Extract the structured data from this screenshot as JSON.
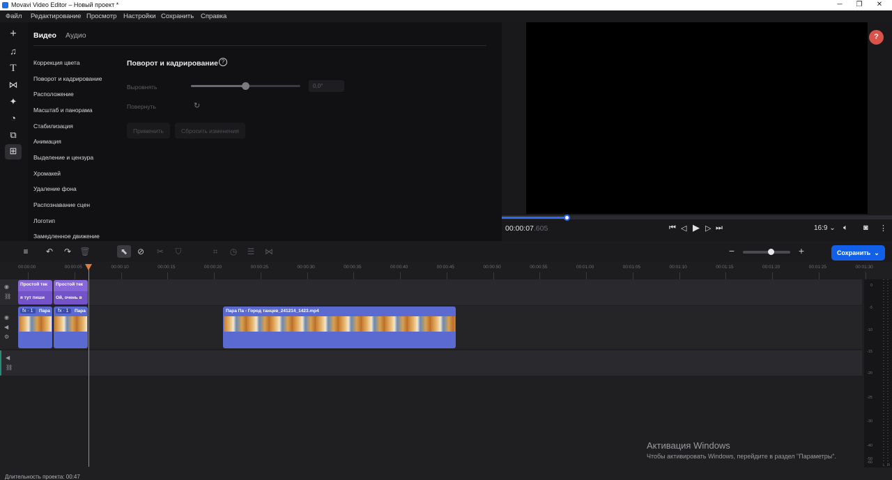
{
  "window": {
    "title": "Movavi Video Editor – Новый проект *",
    "minimize": "─",
    "restore": "❐",
    "close": "✕"
  },
  "menu": [
    "Файл",
    "Редактирование",
    "Просмотр",
    "Настройки",
    "Сохранить",
    "Справка"
  ],
  "left_toolbar": [
    "import-icon",
    "music-icon",
    "titles-icon",
    "transitions-icon",
    "effects-icon",
    "stickers-icon",
    "filters-icon",
    "more-tools-icon"
  ],
  "tabs": {
    "video": "Видео",
    "audio": "Аудио"
  },
  "nav_items": [
    "Коррекция цвета",
    "Поворот и кадрирование",
    "Расположение",
    "Масштаб и панорама",
    "Стабилизация",
    "Анимация",
    "Выделение и цензура",
    "Хромакей",
    "Удаление фона",
    "Распознавание сцен",
    "Логотип",
    "Замедленное движение"
  ],
  "section": {
    "title": "Поворот и кадрирование",
    "help": "?",
    "align_label": "Выровнять",
    "align_value": "0,0°",
    "align_level": 0.5,
    "rotate_label": "Повернуть",
    "apply": "Применить",
    "reset": "Сбросить изменения"
  },
  "preview": {
    "help": "?",
    "timecode_main": "00:00:07",
    "timecode_ms": ".605",
    "progress": 0.167,
    "aspect": "16:9 ⌄"
  },
  "toolbar": {
    "save": "Сохранить",
    "save_caret": "⌄",
    "zoom_level": 0.6
  },
  "ruler": [
    "00:00:00",
    "00:00:05",
    "00:00:10",
    "00:00:15",
    "00:00:20",
    "00:00:25",
    "00:00:30",
    "00:00:35",
    "00:00:40",
    "00:00:45",
    "00:00:50",
    "00:00:55",
    "00:01:00",
    "00:01:05",
    "00:01:10",
    "00:01:15",
    "00:01:20",
    "00:01:25",
    "00:01:30"
  ],
  "clips": {
    "text1_l1": "Простой тек",
    "text1_l2": "я тут пиши",
    "text2_l1": "Простой тек",
    "text2_l2": "Ой, очень в",
    "video1_fx": "fx · 1",
    "video1_name": "Пара",
    "video2_fx": "fx · 1",
    "video2_name": "Пара",
    "video3_name": "Пара Па - Город танцев_241214_1423.mp4"
  },
  "vu_labels": [
    "0",
    "-5",
    "-10",
    "-15",
    "-20",
    "-25",
    "-30",
    "-40",
    "-50",
    "-60"
  ],
  "vu_channels": [
    "L",
    "R"
  ],
  "activation": {
    "title": "Активация Windows",
    "text": "Чтобы активировать Windows, перейдите в раздел \"Параметры\"."
  },
  "status": "Длительность проекта: 00:47"
}
